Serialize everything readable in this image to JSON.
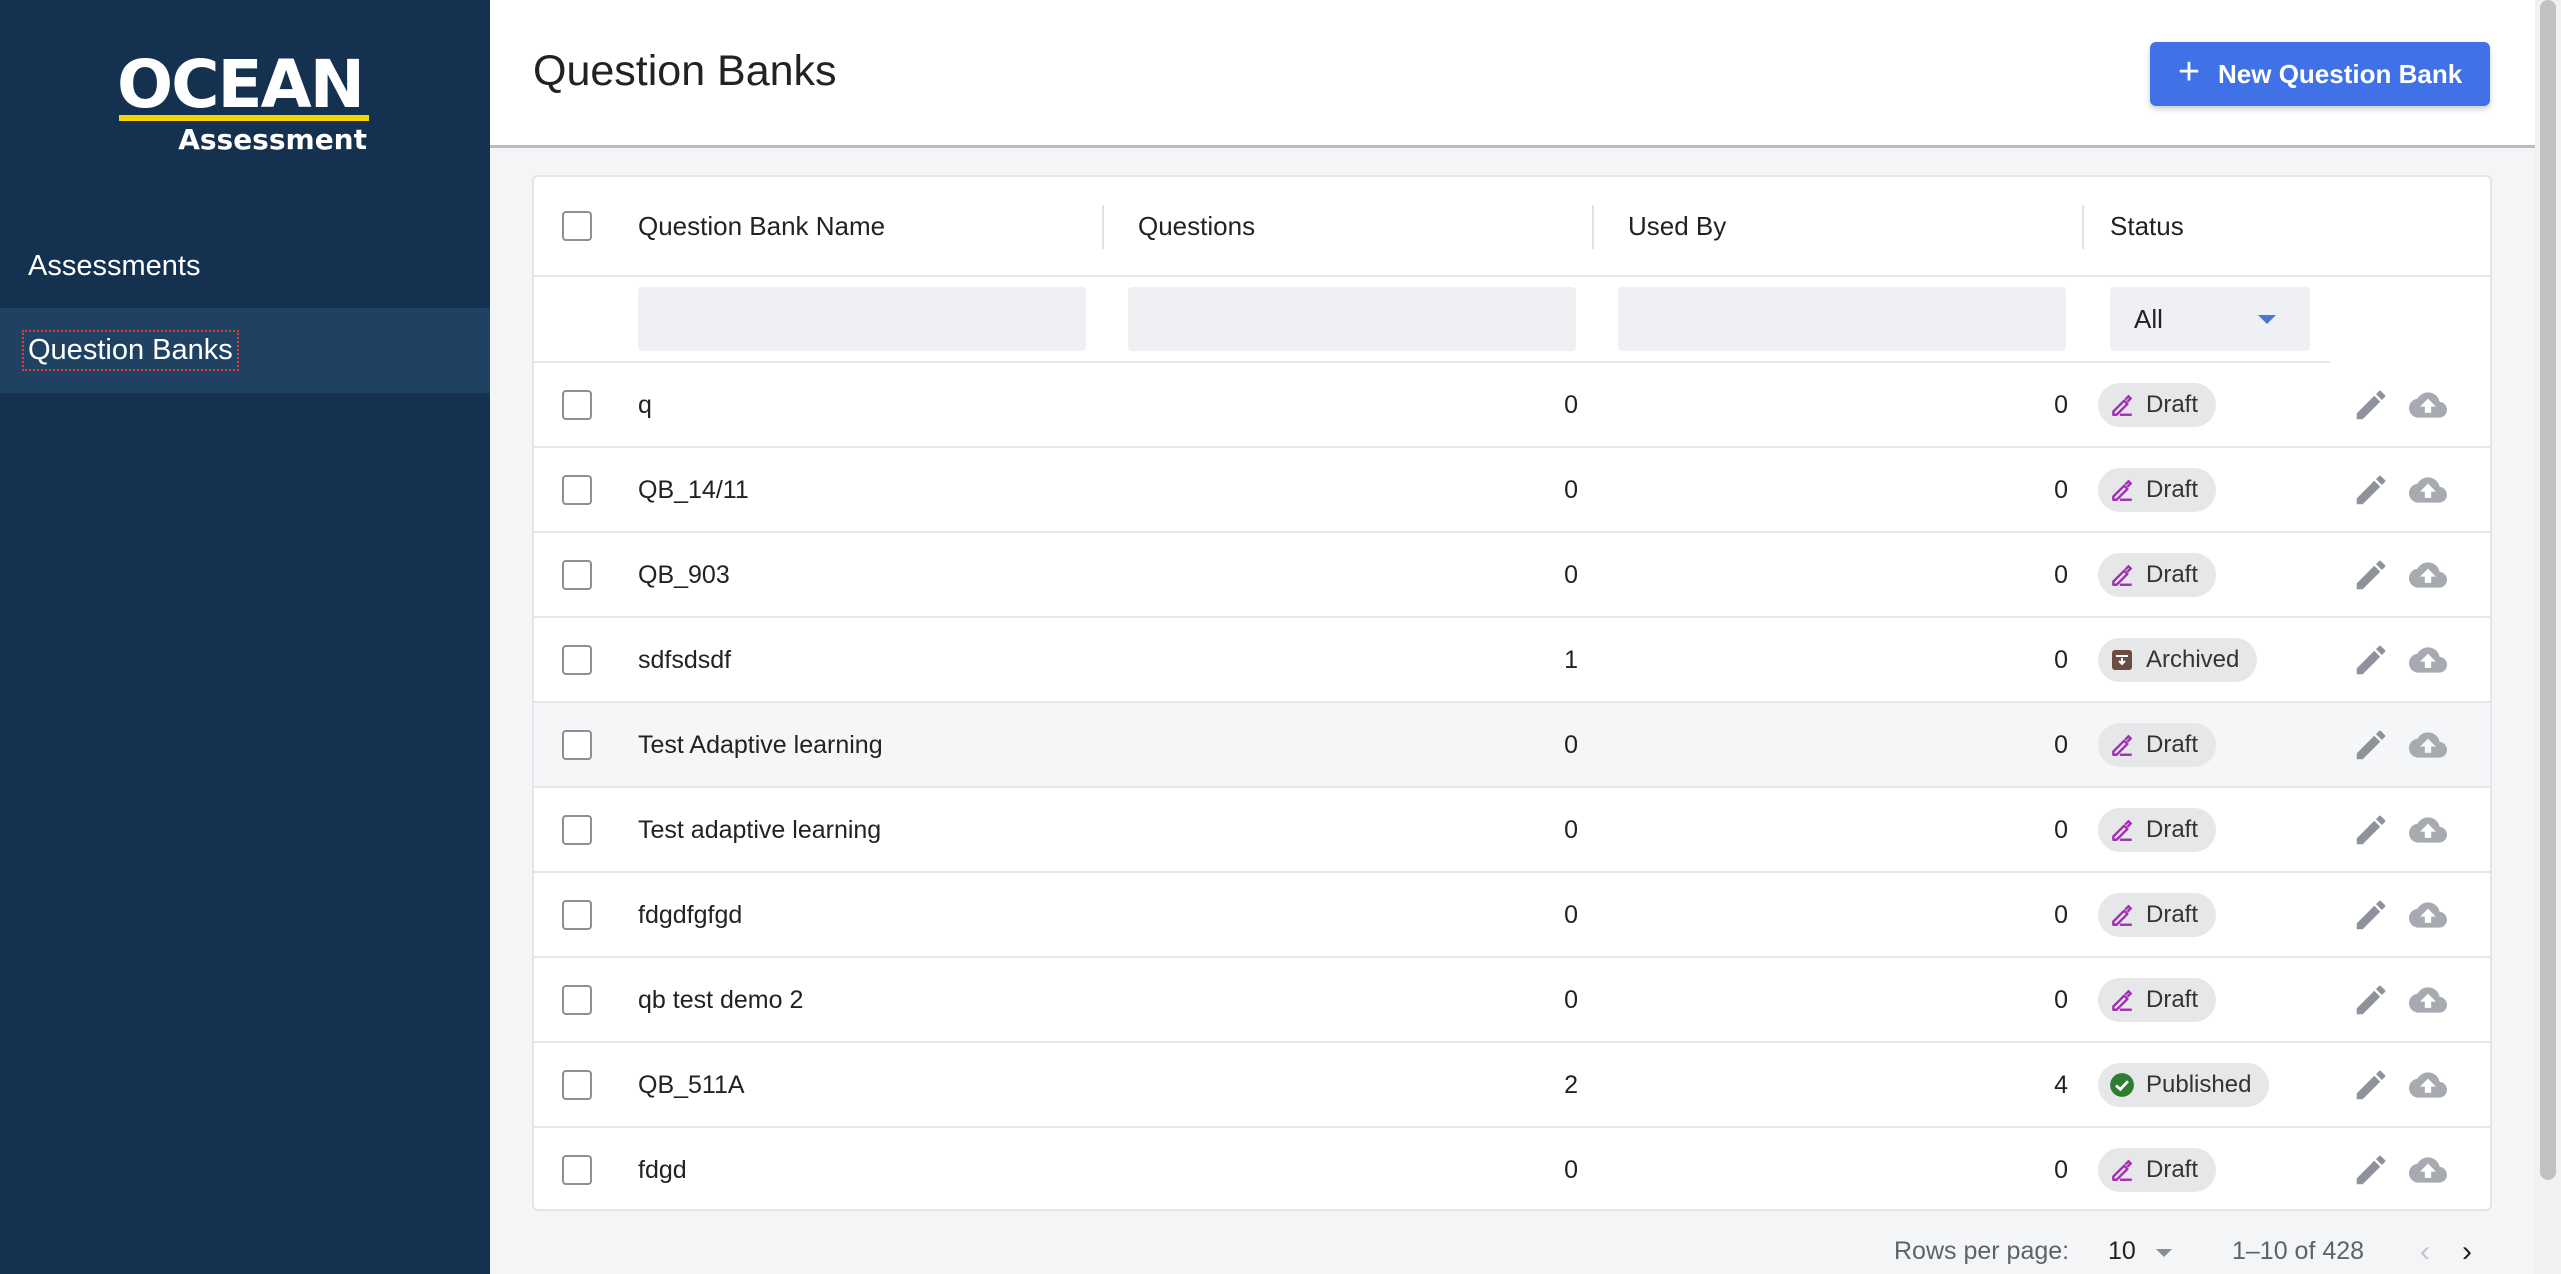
{
  "sidebar": {
    "logo_main": "OCEAN",
    "logo_sub": "Assessment",
    "items": [
      {
        "label": "Assessments",
        "active": false
      },
      {
        "label": "Question Banks",
        "active": true
      }
    ]
  },
  "header": {
    "title": "Question Banks",
    "new_button_label": "New Question Bank",
    "new_button_icon": "plus-icon"
  },
  "table": {
    "columns": [
      "Question Bank Name",
      "Questions",
      "Used By",
      "Status"
    ],
    "status_filter": "All",
    "rows": [
      {
        "name": "q",
        "questions": "0",
        "used_by": "0",
        "status": "Draft"
      },
      {
        "name": "QB_14/11",
        "questions": "0",
        "used_by": "0",
        "status": "Draft"
      },
      {
        "name": "QB_903",
        "questions": "0",
        "used_by": "0",
        "status": "Draft"
      },
      {
        "name": "sdfsdsdf",
        "questions": "1",
        "used_by": "0",
        "status": "Archived"
      },
      {
        "name": "Test Adaptive learning",
        "questions": "0",
        "used_by": "0",
        "status": "Draft"
      },
      {
        "name": "Test adaptive learning",
        "questions": "0",
        "used_by": "0",
        "status": "Draft"
      },
      {
        "name": "fdgdfgfgd",
        "questions": "0",
        "used_by": "0",
        "status": "Draft"
      },
      {
        "name": "qb test demo 2",
        "questions": "0",
        "used_by": "0",
        "status": "Draft"
      },
      {
        "name": "QB_511A",
        "questions": "2",
        "used_by": "4",
        "status": "Published"
      },
      {
        "name": "fdgd",
        "questions": "0",
        "used_by": "0",
        "status": "Draft"
      }
    ],
    "status_colors": {
      "Draft": "#a12fb4",
      "Archived": "#6d4c41",
      "Published": "#2e7d32"
    },
    "row_actions": [
      "edit-icon",
      "upload-icon"
    ]
  },
  "pagination": {
    "rows_per_page_label": "Rows per page:",
    "rows_per_page": "10",
    "range": "1–10 of 428"
  },
  "colors": {
    "sidebar_bg": "#14314f",
    "accent": "#4071e6",
    "logo_bar": "#f5d40b"
  }
}
